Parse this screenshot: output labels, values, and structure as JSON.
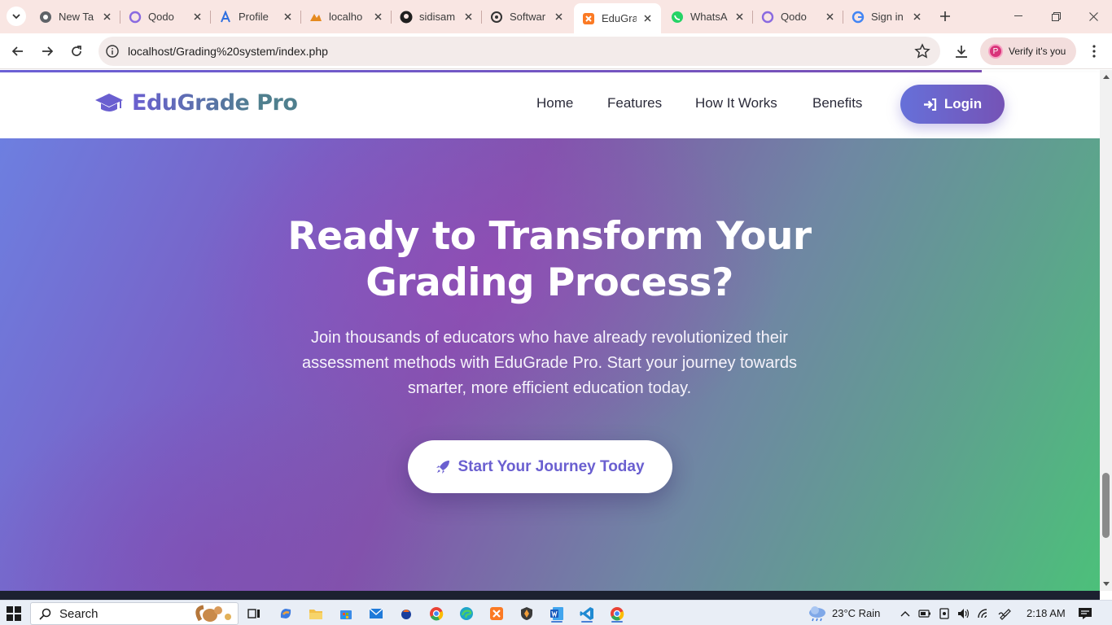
{
  "browser": {
    "tabs": [
      {
        "title": "New Ta",
        "icon": "chrome-icon",
        "active": false
      },
      {
        "title": "Qodo",
        "icon": "qodo-icon",
        "active": false
      },
      {
        "title": "Profile",
        "icon": "profile-a-icon",
        "active": false
      },
      {
        "title": "localho",
        "icon": "phpmyadmin-icon",
        "active": false
      },
      {
        "title": "sidisam",
        "icon": "github-icon",
        "active": false
      },
      {
        "title": "Softwar",
        "icon": "openai-icon",
        "active": false
      },
      {
        "title": "EduGra",
        "icon": "xampp-icon",
        "active": true
      },
      {
        "title": "WhatsA",
        "icon": "whatsapp-icon",
        "active": false
      },
      {
        "title": "Qodo",
        "icon": "qodo-icon",
        "active": false
      },
      {
        "title": "Sign in",
        "icon": "google-icon",
        "active": false
      }
    ],
    "url": "localhost/Grading%20system/index.php",
    "profile_initial": "P",
    "profile_label": "Verify it's you"
  },
  "site": {
    "brand": "EduGrade Pro",
    "nav": [
      "Home",
      "Features",
      "How It Works",
      "Benefits"
    ],
    "login_label": "Login",
    "hero": {
      "title_line1": "Ready to Transform Your",
      "title_line2": "Grading Process?",
      "subtitle": "Join thousands of educators who have already revolutionized their assessment methods with EduGrade Pro. Start your journey towards smarter, more efficient education today.",
      "cta_label": "Start Your Journey Today"
    },
    "colors": {
      "brand_start": "#6a5fd0",
      "brand_end": "#4f7f8e",
      "hero_green": "#4cc07a"
    }
  },
  "taskbar": {
    "search_placeholder": "Search",
    "weather": "23°C  Rain",
    "time": "2:18 AM"
  }
}
